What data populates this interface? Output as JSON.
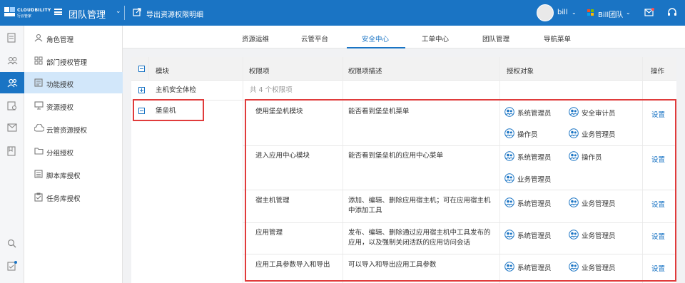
{
  "header": {
    "logo_text": "CLOUDBILITY",
    "logo_sub": "行云管家",
    "app_title": "团队管理",
    "export_label": "导出资源权限明细",
    "user_name": "bill",
    "team_name": "Bill团队",
    "brand_color": "#1a74c4"
  },
  "rail": {
    "items": [
      {
        "icon": "document-icon"
      },
      {
        "icon": "users-outline-icon"
      },
      {
        "icon": "team-icon",
        "active": true
      },
      {
        "icon": "server-icon"
      },
      {
        "icon": "mail-icon"
      },
      {
        "icon": "book-icon"
      },
      {
        "icon": "search-icon"
      },
      {
        "icon": "checklist-icon"
      }
    ]
  },
  "submenu": {
    "items": [
      {
        "label": "角色管理",
        "icon": "user-role-icon"
      },
      {
        "label": "部门授权管理",
        "icon": "department-icon"
      },
      {
        "label": "功能授权",
        "icon": "function-auth-icon",
        "active": true
      },
      {
        "label": "资源授权",
        "icon": "monitor-icon"
      },
      {
        "label": "云管资源授权",
        "icon": "cloud-icon"
      },
      {
        "label": "分组授权",
        "icon": "folder-icon"
      },
      {
        "label": "脚本库授权",
        "icon": "script-icon"
      },
      {
        "label": "任务库授权",
        "icon": "task-icon"
      }
    ]
  },
  "tabs": [
    {
      "label": "资源运维"
    },
    {
      "label": "云管平台"
    },
    {
      "label": "安全中心",
      "active": true
    },
    {
      "label": "工单中心"
    },
    {
      "label": "团队管理"
    },
    {
      "label": "导航菜单"
    }
  ],
  "table": {
    "headers": {
      "module": "模块",
      "permission": "权限项",
      "description": "权限项描述",
      "grantees": "授权对象",
      "action": "操作"
    },
    "modules": [
      {
        "name": "主机安全体检",
        "summary": "共 4 个权限项",
        "expanded": false
      },
      {
        "name": "堡垒机",
        "expanded": true
      }
    ],
    "rows": [
      {
        "permission": "使用堡垒机模块",
        "description": "能否看到堡垒机菜单",
        "grantees": [
          "系统管理员",
          "安全审计员",
          "操作员",
          "业务管理员"
        ],
        "action": "设置"
      },
      {
        "permission": "进入应用中心模块",
        "description": "能否看到堡垒机的应用中心菜单",
        "grantees": [
          "系统管理员",
          "操作员",
          "业务管理员"
        ],
        "action": "设置"
      },
      {
        "permission": "宿主机管理",
        "description": "添加、编辑、删除应用宿主机；可在应用宿主机中添加工具",
        "grantees": [
          "系统管理员",
          "业务管理员"
        ],
        "action": "设置"
      },
      {
        "permission": "应用管理",
        "description": "发布、编辑、删除通过应用宿主机中工具发布的应用，以及强制关闭活跃的应用访问会话",
        "grantees": [
          "系统管理员",
          "业务管理员"
        ],
        "action": "设置"
      },
      {
        "permission": "应用工具参数导入和导出",
        "description": "可以导入和导出应用工具参数",
        "grantees": [
          "系统管理员",
          "业务管理员"
        ],
        "action": "设置"
      }
    ]
  },
  "highlight_color": "#e03b3b"
}
